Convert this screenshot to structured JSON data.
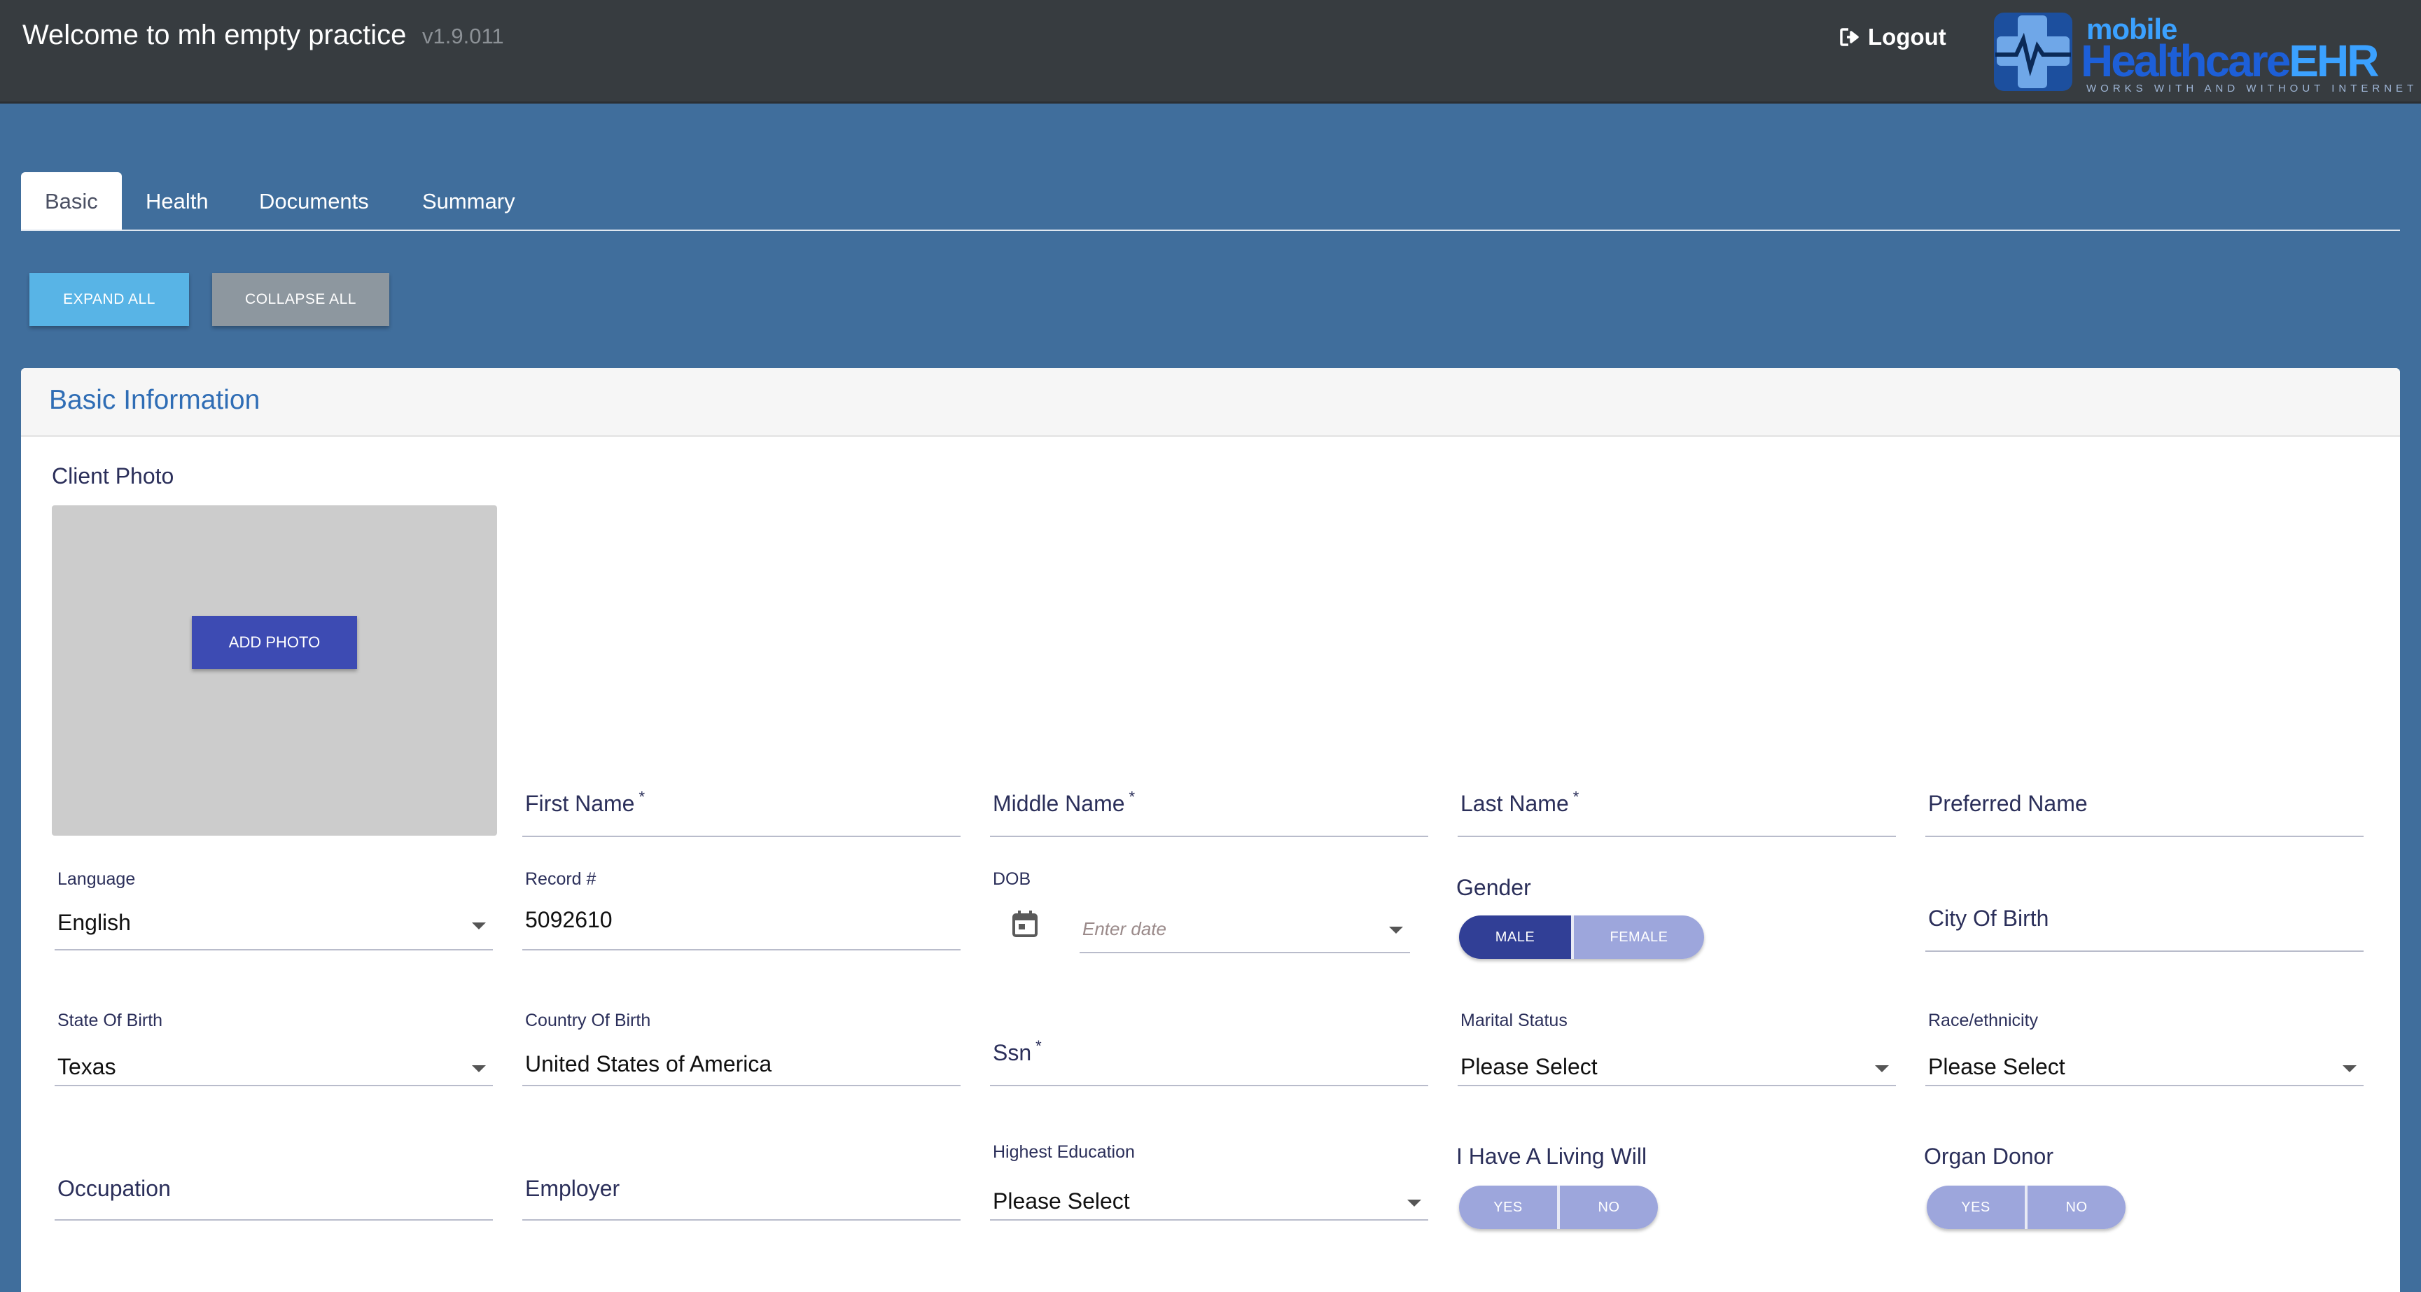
{
  "header": {
    "welcome": "Welcome to mh empty practice",
    "version": "v1.9.011",
    "logout_label": "Logout",
    "logo": {
      "word1": "mobile",
      "word2a": "Healthcare",
      "word2b": "EHR",
      "tagline": "WORKS WITH AND WITHOUT INTERNET"
    }
  },
  "tabs": [
    {
      "label": "Basic",
      "active": true
    },
    {
      "label": "Health",
      "active": false
    },
    {
      "label": "Documents",
      "active": false
    },
    {
      "label": "Summary",
      "active": false
    }
  ],
  "actions": {
    "expand_all": "EXPAND ALL",
    "collapse_all": "COLLAPSE ALL"
  },
  "section": {
    "title": "Basic Information",
    "photo_label": "Client Photo",
    "add_photo": "ADD PHOTO"
  },
  "fields": {
    "first_name": {
      "label": "First Name",
      "required": "*",
      "value": ""
    },
    "middle_name": {
      "label": "Middle Name",
      "required": "*",
      "value": ""
    },
    "last_name": {
      "label": "Last Name",
      "required": "*",
      "value": ""
    },
    "preferred_name": {
      "label": "Preferred Name",
      "value": ""
    },
    "language": {
      "label": "Language",
      "value": "English"
    },
    "record": {
      "label": "Record #",
      "value": "5092610"
    },
    "dob": {
      "label": "DOB",
      "placeholder": "Enter date"
    },
    "gender": {
      "label": "Gender",
      "options": [
        "MALE",
        "FEMALE"
      ],
      "selected": "MALE"
    },
    "city_of_birth": {
      "label": "City Of Birth",
      "value": ""
    },
    "state_of_birth": {
      "label": "State Of Birth",
      "value": "Texas"
    },
    "country_of_birth": {
      "label": "Country Of Birth",
      "value": "United States of America"
    },
    "ssn": {
      "label": "Ssn",
      "required": "*",
      "value": ""
    },
    "marital_status": {
      "label": "Marital Status",
      "value": "Please Select"
    },
    "race_ethnicity": {
      "label": "Race/ethnicity",
      "value": "Please Select"
    },
    "occupation": {
      "label": "Occupation",
      "value": ""
    },
    "employer": {
      "label": "Employer",
      "value": ""
    },
    "highest_education": {
      "label": "Highest Education",
      "value": "Please Select"
    },
    "living_will": {
      "label": "I Have A Living Will",
      "options": [
        "YES",
        "NO"
      ],
      "selected": ""
    },
    "organ_donor": {
      "label": "Organ Donor",
      "options": [
        "YES",
        "NO"
      ],
      "selected": ""
    }
  },
  "colors": {
    "accent": "#3d4bb3",
    "header_bg": "#373c40",
    "page_bg": "#406e9c",
    "title": "#2f6db5"
  }
}
